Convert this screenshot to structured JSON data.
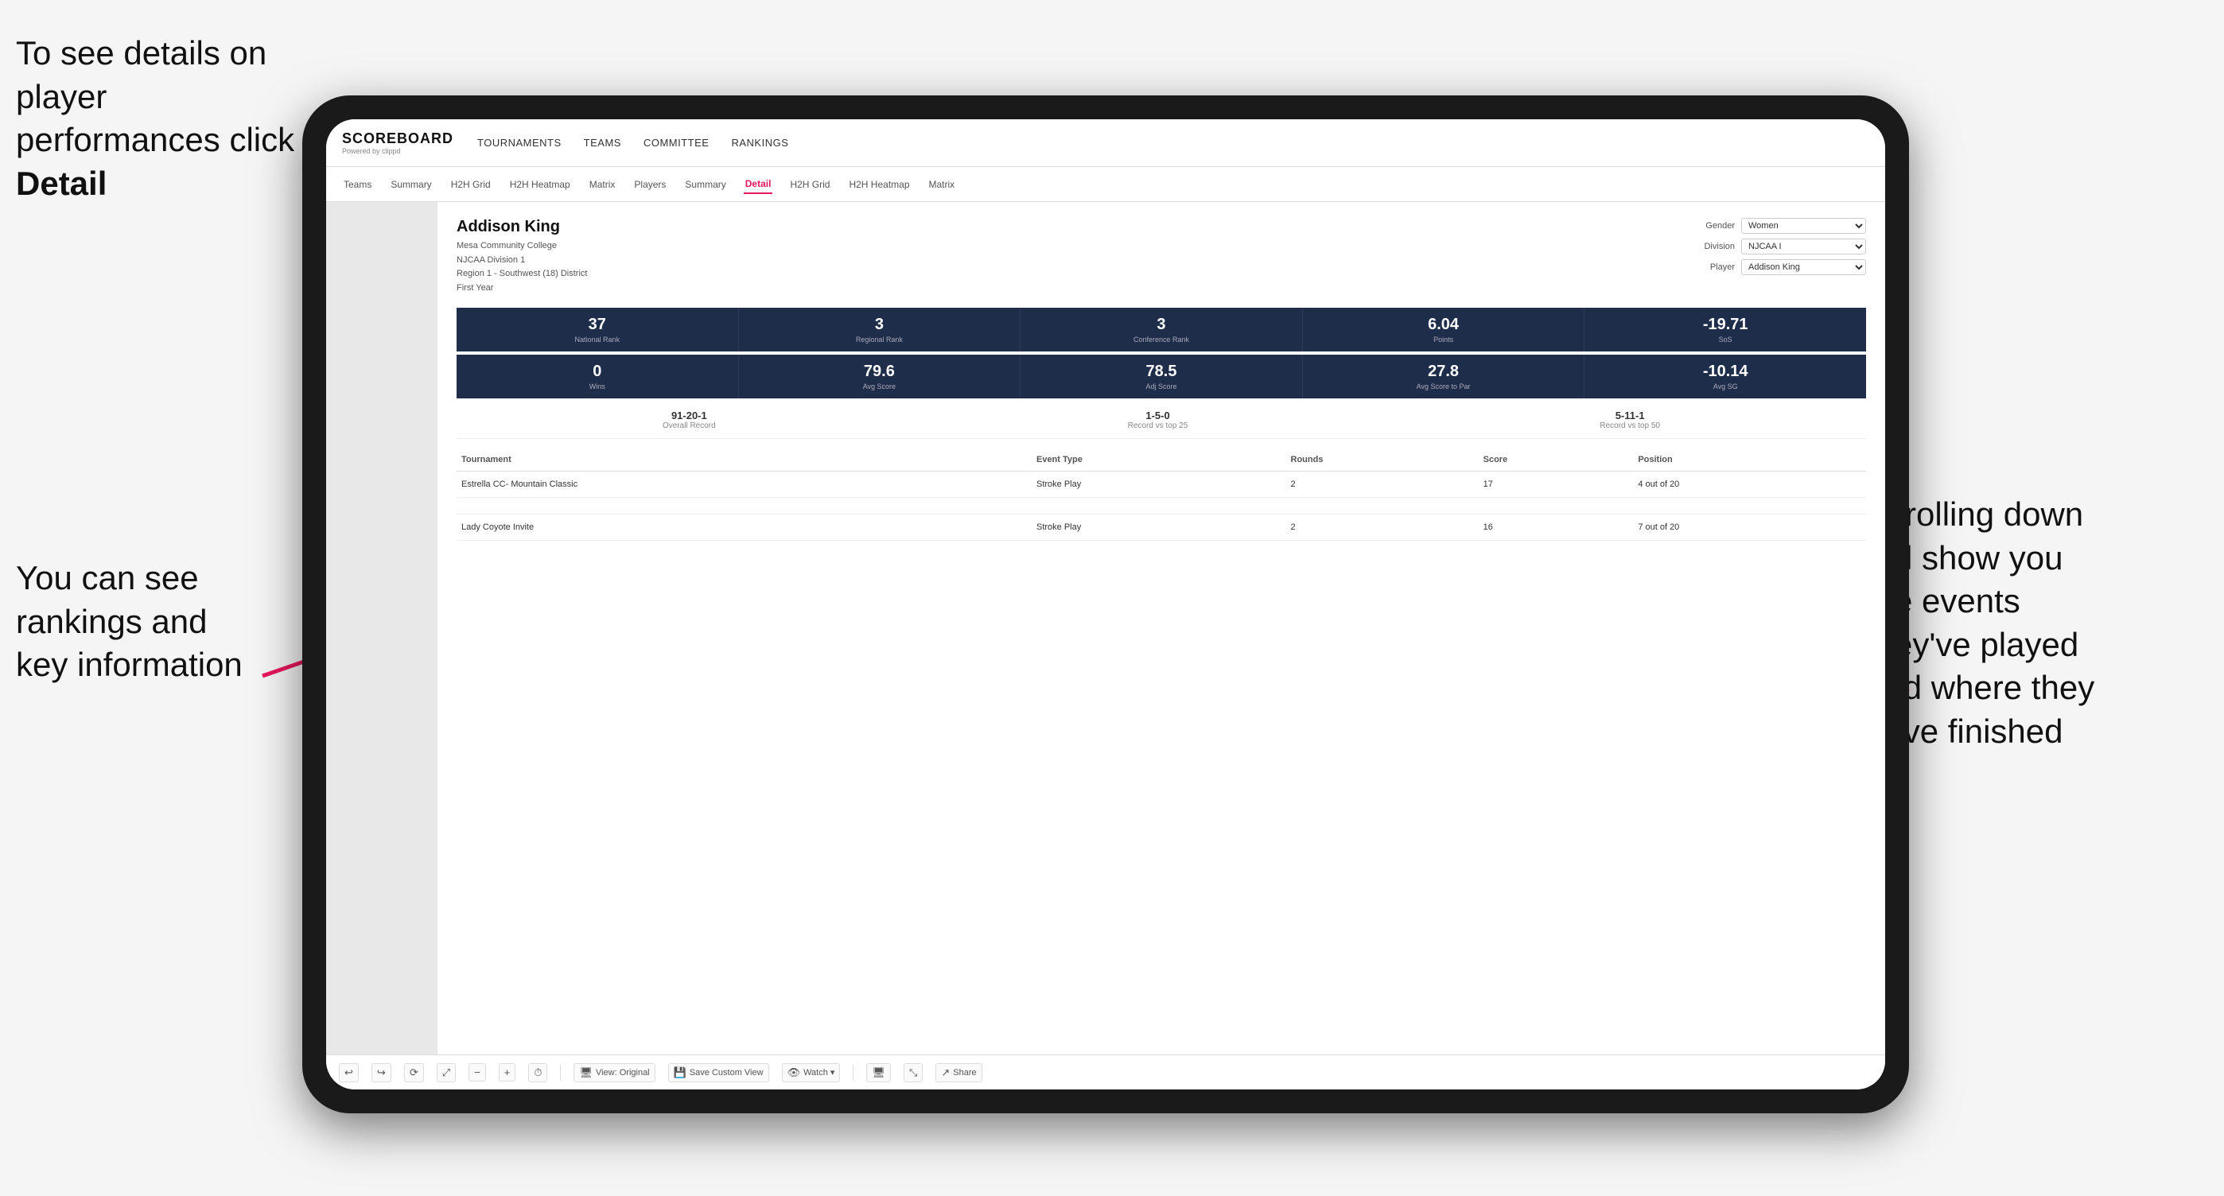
{
  "annotations": {
    "top_left": "To see details on player performances click ",
    "top_left_bold": "Detail",
    "bottom_left_line1": "You can see",
    "bottom_left_line2": "rankings and",
    "bottom_left_line3": "key information",
    "right_line1": "Scrolling down",
    "right_line2": "will show you",
    "right_line3": "the events",
    "right_line4": "they've played",
    "right_line5": "and where they",
    "right_line6": "have finished"
  },
  "app": {
    "logo_main": "SCOREBOARD",
    "logo_sub": "Powered by clippd",
    "top_nav": [
      {
        "label": "TOURNAMENTS",
        "active": false
      },
      {
        "label": "TEAMS",
        "active": false
      },
      {
        "label": "COMMITTEE",
        "active": false
      },
      {
        "label": "RANKINGS",
        "active": false
      }
    ],
    "sub_nav": [
      {
        "label": "Teams",
        "active": false
      },
      {
        "label": "Summary",
        "active": false
      },
      {
        "label": "H2H Grid",
        "active": false
      },
      {
        "label": "H2H Heatmap",
        "active": false
      },
      {
        "label": "Matrix",
        "active": false
      },
      {
        "label": "Players",
        "active": false
      },
      {
        "label": "Summary",
        "active": false
      },
      {
        "label": "Detail",
        "active": true
      },
      {
        "label": "H2H Grid",
        "active": false
      },
      {
        "label": "H2H Heatmap",
        "active": false
      },
      {
        "label": "Matrix",
        "active": false
      }
    ]
  },
  "player": {
    "name": "Addison King",
    "college": "Mesa Community College",
    "division": "NJCAA Division 1",
    "region": "Region 1 - Southwest (18) District",
    "year": "First Year"
  },
  "controls": {
    "gender_label": "Gender",
    "gender_value": "Women",
    "division_label": "Division",
    "division_value": "NJCAA I",
    "player_label": "Player",
    "player_value": "Addison King"
  },
  "stats_row1": [
    {
      "value": "37",
      "label": "National Rank"
    },
    {
      "value": "3",
      "label": "Regional Rank"
    },
    {
      "value": "3",
      "label": "Conference Rank"
    },
    {
      "value": "6.04",
      "label": "Points"
    },
    {
      "value": "-19.71",
      "label": "SoS"
    }
  ],
  "stats_row2": [
    {
      "value": "0",
      "label": "Wins"
    },
    {
      "value": "79.6",
      "label": "Avg Score"
    },
    {
      "value": "78.5",
      "label": "Adj Score"
    },
    {
      "value": "27.8",
      "label": "Avg Score to Par"
    },
    {
      "value": "-10.14",
      "label": "Avg SG"
    }
  ],
  "records": [
    {
      "value": "91-20-1",
      "label": "Overall Record"
    },
    {
      "value": "1-5-0",
      "label": "Record vs top 25"
    },
    {
      "value": "5-11-1",
      "label": "Record vs top 50"
    }
  ],
  "table": {
    "headers": [
      "Tournament",
      "Event Type",
      "Rounds",
      "Score",
      "Position"
    ],
    "rows": [
      {
        "tournament": "Estrella CC- Mountain Classic",
        "event_type": "Stroke Play",
        "rounds": "2",
        "score": "17",
        "position": "4 out of 20"
      },
      {
        "tournament": "Lady Coyote Invite",
        "event_type": "Stroke Play",
        "rounds": "2",
        "score": "16",
        "position": "7 out of 20"
      }
    ]
  },
  "toolbar": {
    "buttons": [
      {
        "icon": "↩",
        "label": ""
      },
      {
        "icon": "↪",
        "label": ""
      },
      {
        "icon": "⟳",
        "label": ""
      },
      {
        "icon": "⤢",
        "label": ""
      },
      {
        "icon": "−",
        "label": ""
      },
      {
        "icon": "+",
        "label": ""
      },
      {
        "icon": "⏱",
        "label": ""
      },
      {
        "icon": "🖥",
        "label": "View: Original"
      },
      {
        "icon": "💾",
        "label": "Save Custom View"
      },
      {
        "icon": "👁",
        "label": "Watch ▾"
      },
      {
        "icon": "🖥",
        "label": ""
      },
      {
        "icon": "⤡",
        "label": ""
      },
      {
        "icon": "⤢",
        "label": "Share"
      }
    ]
  }
}
